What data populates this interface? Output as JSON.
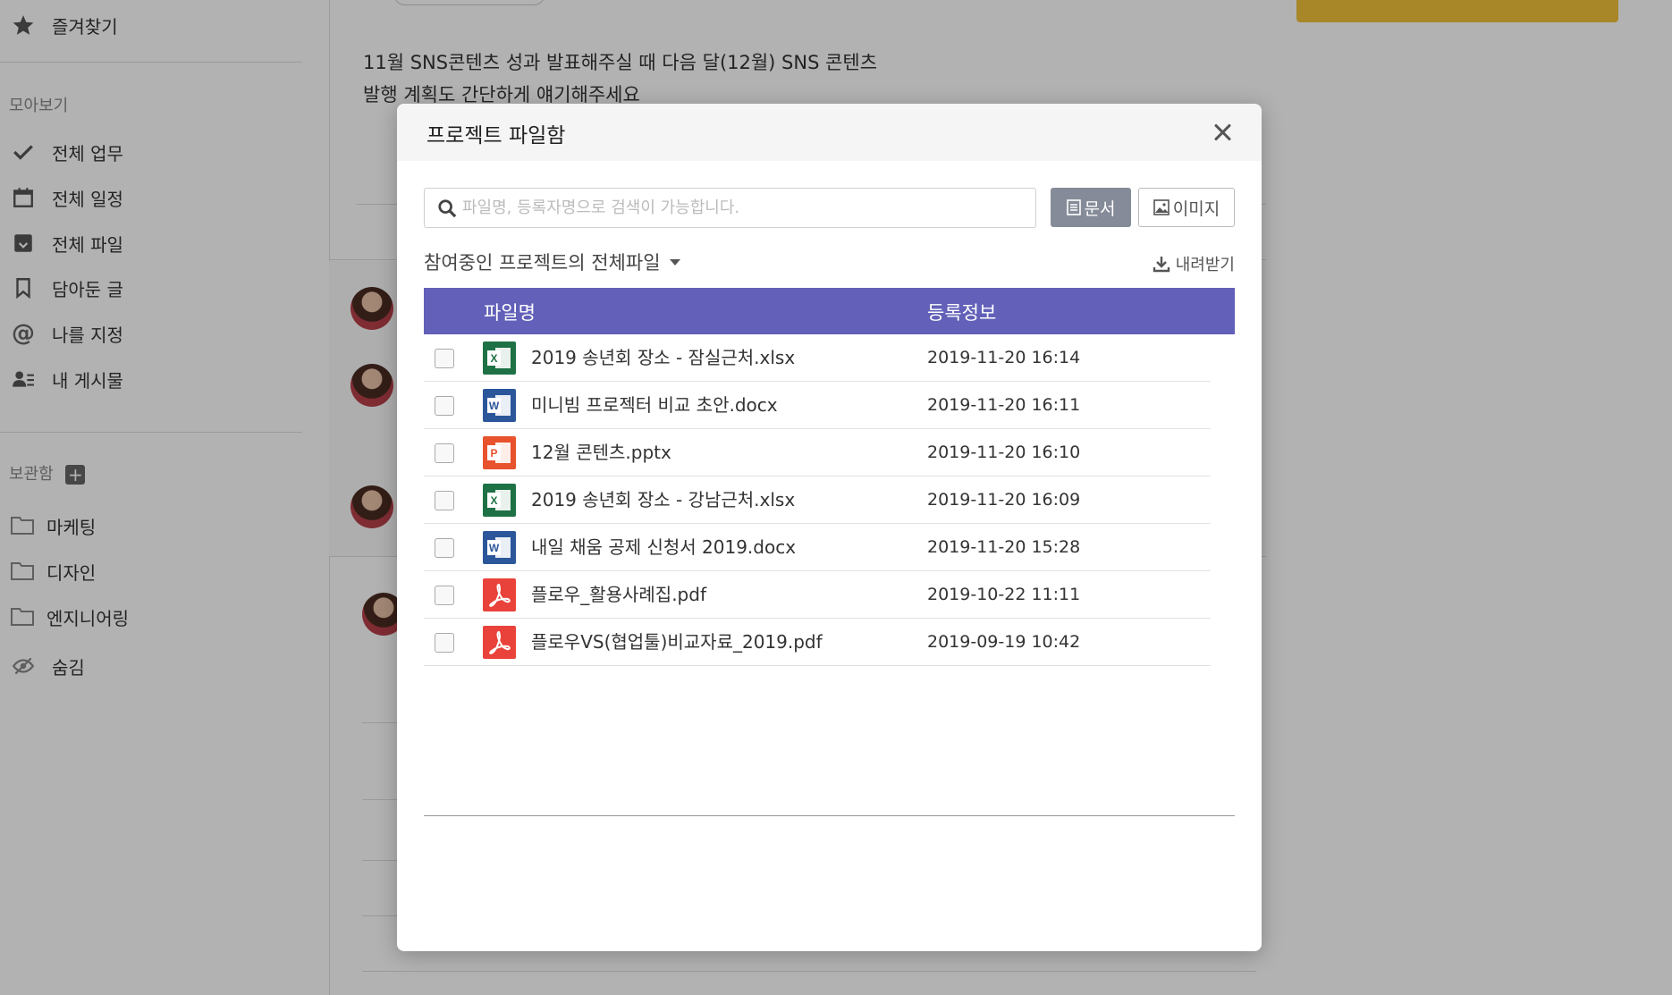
{
  "sidebar": {
    "favorites_label": "즐겨찾기",
    "collect_heading": "모아보기",
    "items": [
      {
        "label": "전체 업무"
      },
      {
        "label": "전체 일정"
      },
      {
        "label": "전체 파일"
      },
      {
        "label": "담아둔 글"
      },
      {
        "label": "나를 지정"
      },
      {
        "label": "내 게시물"
      }
    ],
    "storage_heading": "보관함",
    "folders": [
      {
        "label": "마케팅"
      },
      {
        "label": "디자인"
      },
      {
        "label": "엔지니어링"
      }
    ],
    "hidden_label": "숨김"
  },
  "feed": {
    "line1": "11월 SNS콘텐츠 성과 발표해주실 때 다음 달(12월) SNS 콘텐츠",
    "line2": "발행 계획도 간단하게 얘기해주세요"
  },
  "modal": {
    "title": "프로젝트 파일함",
    "search_placeholder": "파일명, 등록자명으로 검색이 가능합니다.",
    "search_value": "",
    "doc_button": "문서",
    "image_button": "이미지",
    "filter_label": "참여중인 프로젝트의 전체파일",
    "download_label": "내려받기",
    "col_name": "파일명",
    "col_info": "등록정보",
    "files": [
      {
        "type": "xlsx",
        "name": "2019 송년회 장소 - 잠실근처.xlsx",
        "date": "2019-11-20 16:14"
      },
      {
        "type": "docx",
        "name": "미니빔 프로젝터 비교 초안.docx",
        "date": "2019-11-20 16:11"
      },
      {
        "type": "pptx",
        "name": "12월 콘텐츠.pptx",
        "date": "2019-11-20 16:10"
      },
      {
        "type": "xlsx",
        "name": "2019 송년회 장소 - 강남근처.xlsx",
        "date": "2019-11-20 16:09"
      },
      {
        "type": "docx",
        "name": "내일 채움 공제 신청서 2019.docx",
        "date": "2019-11-20 15:28"
      },
      {
        "type": "pdf",
        "name": "플로우_활용사례집.pdf",
        "date": "2019-10-22 11:11"
      },
      {
        "type": "pdf",
        "name": "플로우VS(협업툴)비교자료_2019.pdf",
        "date": "2019-09-19 10:42"
      }
    ]
  },
  "colors": {
    "table_header": "#6260b8",
    "doc_button": "#858b98",
    "xlsx": "#1e7145",
    "docx": "#2b579a",
    "pptx": "#e8522c",
    "pdf": "#e9423a",
    "accent_yellow": "#f1c23a"
  }
}
